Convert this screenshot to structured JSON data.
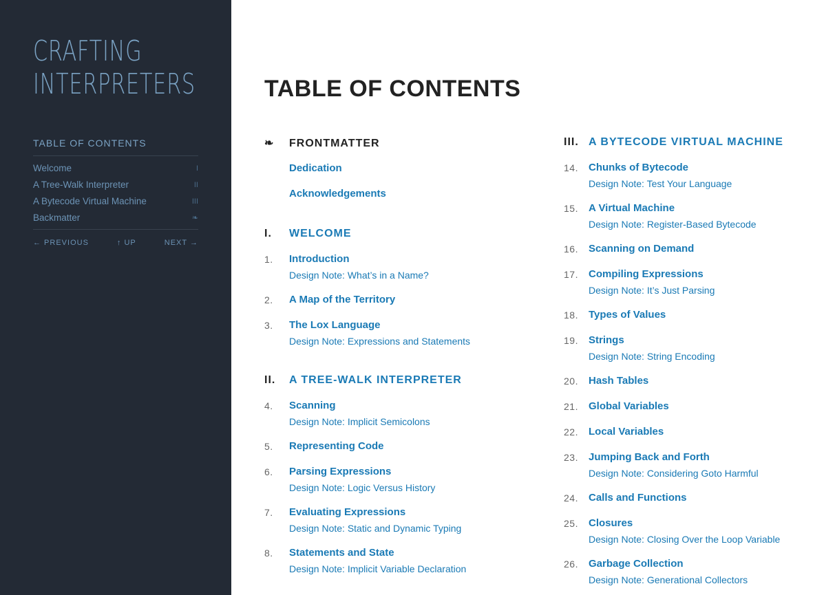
{
  "sidebar": {
    "logo_line1": "CRAFTING",
    "logo_line2": "INTERPRETERS",
    "toc_title": "TABLE OF CONTENTS",
    "items": [
      {
        "label": "Welcome",
        "mark": "I"
      },
      {
        "label": "A Tree-Walk Interpreter",
        "mark": "II"
      },
      {
        "label": "A Bytecode Virtual Machine",
        "mark": "III"
      },
      {
        "label": "Backmatter",
        "mark": "❧"
      }
    ],
    "nav": {
      "previous": "← PREVIOUS",
      "up": "↑ UP",
      "next": "NEXT →"
    }
  },
  "main": {
    "title": "TABLE OF CONTENTS",
    "frontmatter": {
      "mark": "❧",
      "title": "FRONTMATTER",
      "items": [
        "Dedication",
        "Acknowledgements"
      ]
    },
    "part1": {
      "num": "I.",
      "title": "WELCOME",
      "chapters": [
        {
          "num": "1.",
          "title": "Introduction",
          "note": "Design Note: What’s in a Name?"
        },
        {
          "num": "2.",
          "title": "A Map of the Territory",
          "note": ""
        },
        {
          "num": "3.",
          "title": "The Lox Language",
          "note": "Design Note: Expressions and Statements"
        }
      ]
    },
    "part2": {
      "num": "II.",
      "title": "A TREE-WALK INTERPRETER",
      "chapters": [
        {
          "num": "4.",
          "title": "Scanning",
          "note": "Design Note: Implicit Semicolons"
        },
        {
          "num": "5.",
          "title": "Representing Code",
          "note": ""
        },
        {
          "num": "6.",
          "title": "Parsing Expressions",
          "note": "Design Note: Logic Versus History"
        },
        {
          "num": "7.",
          "title": "Evaluating Expressions",
          "note": "Design Note: Static and Dynamic Typing"
        },
        {
          "num": "8.",
          "title": "Statements and State",
          "note": "Design Note: Implicit Variable Declaration"
        }
      ]
    },
    "part3": {
      "num": "III.",
      "title": "A BYTECODE VIRTUAL MACHINE",
      "chapters": [
        {
          "num": "14.",
          "title": "Chunks of Bytecode",
          "note": "Design Note: Test Your Language"
        },
        {
          "num": "15.",
          "title": "A Virtual Machine",
          "note": "Design Note: Register-Based Bytecode"
        },
        {
          "num": "16.",
          "title": "Scanning on Demand",
          "note": ""
        },
        {
          "num": "17.",
          "title": "Compiling Expressions",
          "note": "Design Note: It’s Just Parsing"
        },
        {
          "num": "18.",
          "title": "Types of Values",
          "note": ""
        },
        {
          "num": "19.",
          "title": "Strings",
          "note": "Design Note: String Encoding"
        },
        {
          "num": "20.",
          "title": "Hash Tables",
          "note": ""
        },
        {
          "num": "21.",
          "title": "Global Variables",
          "note": ""
        },
        {
          "num": "22.",
          "title": "Local Variables",
          "note": ""
        },
        {
          "num": "23.",
          "title": "Jumping Back and Forth",
          "note": "Design Note: Considering Goto Harmful"
        },
        {
          "num": "24.",
          "title": "Calls and Functions",
          "note": ""
        },
        {
          "num": "25.",
          "title": "Closures",
          "note": "Design Note: Closing Over the Loop Variable"
        },
        {
          "num": "26.",
          "title": "Garbage Collection",
          "note": "Design Note: Generational Collectors"
        }
      ]
    }
  }
}
